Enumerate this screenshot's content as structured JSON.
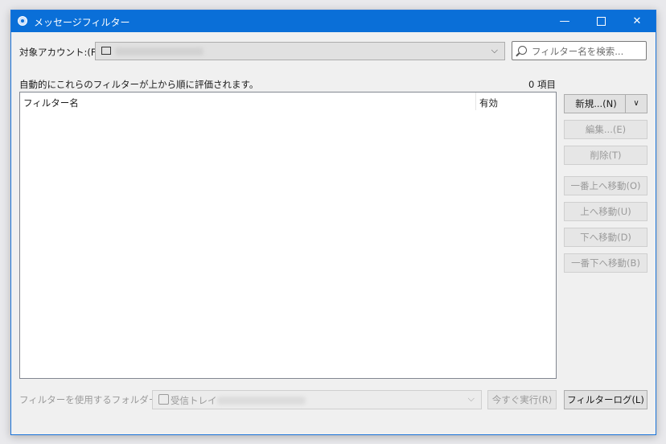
{
  "window": {
    "title": "メッセージフィルター",
    "minimize": "—",
    "close": "✕"
  },
  "account": {
    "label": "対象アカウント:(F)",
    "arrow": "⌵"
  },
  "search": {
    "placeholder": "フィルター名を検索..."
  },
  "description": "自動的にこれらのフィルターが上から順に評価されます。",
  "item_count": "0 項目",
  "table": {
    "columns": [
      "フィルター名",
      "有効"
    ],
    "rows": []
  },
  "buttons": {
    "new": "新規...(N)",
    "new_arrow": "∨",
    "edit": "編集...(E)",
    "delete": "削除(T)",
    "move_top": "一番上へ移動(O)",
    "move_up": "上へ移動(U)",
    "move_down": "下へ移動(D)",
    "move_bottom": "一番下へ移動(B)",
    "run_now": "今すぐ実行(R)",
    "filter_log": "フィルターログ(L)"
  },
  "folder": {
    "label": "フィルターを使用するフォルダー:(C)",
    "value": "受信トレイ",
    "arrow": "⌵"
  }
}
